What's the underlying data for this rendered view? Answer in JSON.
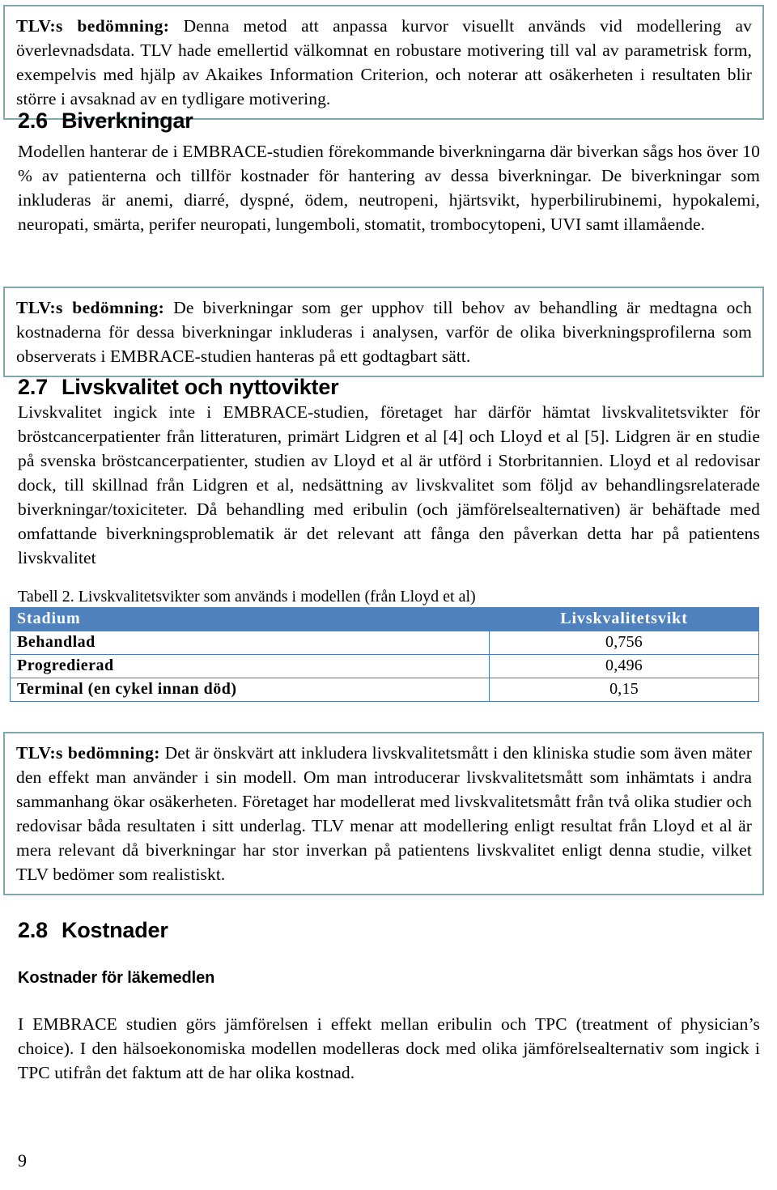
{
  "document": {
    "page_number": "9",
    "colors": {
      "callout_border": "#7fa8b0",
      "table_header_bg": "#4f81bd",
      "table_border": "#4a7ebb",
      "text": "#000000"
    }
  },
  "callouts": {
    "survival": {
      "label": "TLV:s bedömning:",
      "text": " Denna metod att anpassa kurvor visuellt används vid modellering av överlevnadsdata. TLV hade emellertid välkomnat en robustare motivering till val av parametrisk form, exempelvis med hjälp av Akaikes Information Criterion, och noterar att osäkerheten i resultaten blir större i avsaknad av en tydligare motivering."
    },
    "adverse_events": {
      "label": "TLV:s bedömning:",
      "text": " De biverkningar som ger upphov till behov av behandling är medtagna och kostnaderna för dessa biverkningar inkluderas i analysen, varför de olika biverkningsprofilerna som observerats i EMBRACE-studien hanteras på ett godtagbart sätt."
    },
    "quality_of_life": {
      "label": "TLV:s bedömning:",
      "text": " Det är önskvärt att inkludera livskvalitetsmått i den kliniska studie som även mäter den effekt man använder i sin modell. Om man introducerar livskvalitetsmått som inhämtats i andra sammanhang ökar osäkerheten. Företaget har modellerat med livskvalitetsmått från två olika studier och redovisar båda resultaten i sitt underlag. TLV menar att modellering enligt resultat från Lloyd et al är mera relevant då biverkningar har stor inverkan på patientens livskvalitet enligt denna studie, vilket TLV bedömer som realistiskt."
    }
  },
  "sections": {
    "adverse_events": {
      "number": "2.6",
      "title": "Biverkningar",
      "body": "Modellen hanterar de i EMBRACE-studien förekommande biverkningarna där biverkan sågs hos över 10 % av patienterna och tillför kostnader för hantering av dessa biverkningar. De biverkningar som inkluderas är anemi, diarré, dyspné, ödem, neutropeni, hjärtsvikt, hyperbilirubinemi, hypokalemi, neuropati, smärta, perifer neuropati, lungemboli, stomatit, trombocytopeni, UVI samt illamående."
    },
    "quality_of_life": {
      "number": "2.7",
      "title": "Livskvalitet och nyttovikter",
      "body": "Livskvalitet ingick inte i EMBRACE-studien, företaget har därför hämtat livskvalitetsvikter för bröstcancerpatienter från litteraturen, primärt Lidgren et al [4] och Lloyd et al [5]. Lidgren är en studie på svenska bröstcancerpatienter, studien av Lloyd et al är utförd i Storbritannien. Lloyd et al redovisar dock, till skillnad från Lidgren et al, nedsättning av livskvalitet som följd av behandlingsrelaterade biverkningar/toxiciteter. Då behandling med eribulin (och jämförelsealternativen) är behäftade med omfattande biverkningsproblematik är det relevant att fånga den påverkan detta har på patientens livskvalitet"
    },
    "costs": {
      "number": "2.8",
      "title": "Kostnader",
      "subheading": "Kostnader för läkemedlen",
      "body": "I EMBRACE studien görs jämförelsen i effekt mellan eribulin och TPC (treatment of physician’s choice). I den hälsoekonomiska modellen modelleras dock med olika jämförelsealternativ som ingick i TPC utifrån det faktum att de har olika kostnad."
    }
  },
  "table": {
    "caption": "Tabell 2. Livskvalitetsvikter som används i modellen (från Lloyd et al)",
    "headers": [
      "Stadium",
      "Livskvalitetsvikt"
    ],
    "rows": [
      {
        "stage": "Behandlad",
        "weight": "0,756"
      },
      {
        "stage": "Progredierad",
        "weight": "0,496"
      },
      {
        "stage": "Terminal (en cykel innan död)",
        "weight": "0,15"
      }
    ]
  }
}
